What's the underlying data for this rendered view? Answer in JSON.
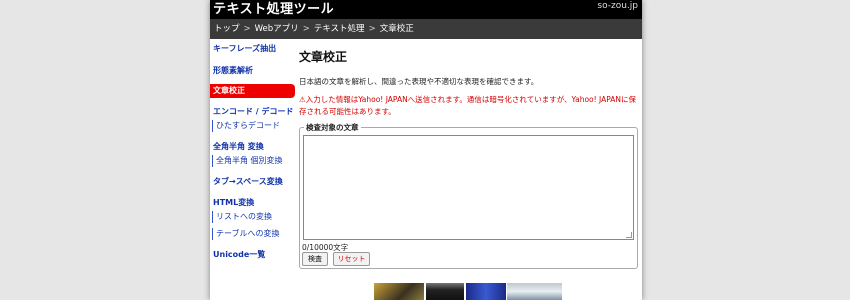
{
  "header": {
    "title": "テキスト処理ツール",
    "domain": "so-zou.jp"
  },
  "breadcrumb": [
    "トップ",
    "Webアプリ",
    "テキスト処理",
    "文章校正"
  ],
  "breadcrumb_separator": ">",
  "sidebar": {
    "items": [
      {
        "label": "キーフレーズ抽出",
        "type": "link"
      },
      {
        "label": "形態素解析",
        "type": "link"
      },
      {
        "label": "文章校正",
        "type": "active"
      },
      {
        "label": "エンコード / デコード",
        "type": "link"
      },
      {
        "label": "ひたすらデコード",
        "type": "sub"
      },
      {
        "label": "全角半角 変換",
        "type": "link"
      },
      {
        "label": "全角半角 個別変換",
        "type": "sub"
      },
      {
        "label": "タブ→スペース変換",
        "type": "link"
      },
      {
        "label": "HTML変換",
        "type": "link"
      },
      {
        "label": "リストへの変換",
        "type": "sub"
      },
      {
        "label": "テーブルへの変換",
        "type": "sub"
      },
      {
        "label": "Unicode一覧",
        "type": "link"
      }
    ]
  },
  "main": {
    "title": "文章校正",
    "description": "日本語の文章を解析し、間違った表現や不適切な表現を確認できます。",
    "warning": "⚠入力した情報はYahoo! JAPANへ送信されます。通信は暗号化されていますが、Yahoo! JAPANに保存される可能性はあります。",
    "form": {
      "legend": "検査対象の文章",
      "textarea_value": "",
      "counter": "0/10000文字",
      "check_label": "検査",
      "reset_label": "リセット"
    }
  },
  "colors": {
    "topbar": "#000000",
    "breadcrumb": "#3a3a3a",
    "link": "#1133aa",
    "active": "#ee0000",
    "warning": "#d40000"
  }
}
